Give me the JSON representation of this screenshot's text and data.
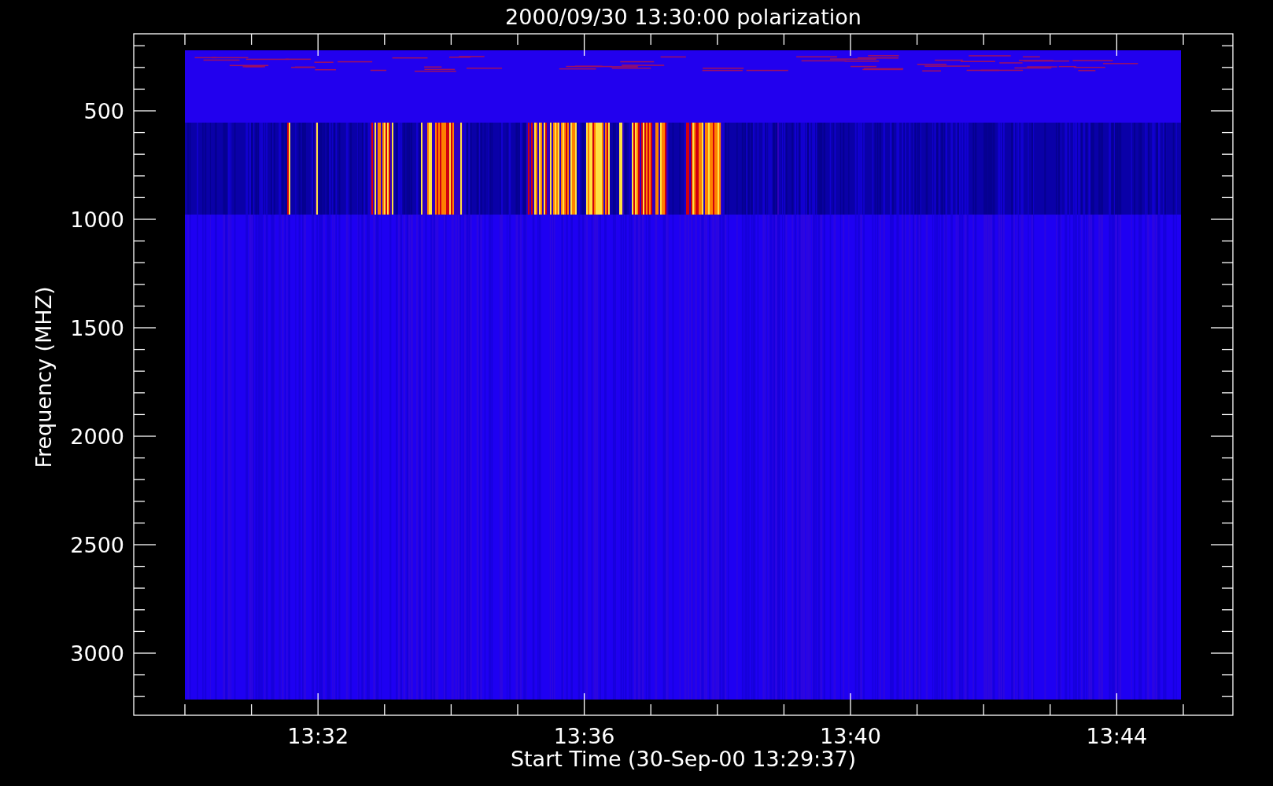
{
  "plot": {
    "title": "2000/09/30 13:30:00 polarization",
    "xlabel": "Start Time (30-Sep-00 13:29:37)",
    "ylabel": "Frequency (MHZ)",
    "yticks": [
      "500",
      "1000",
      "1500",
      "2000",
      "2500",
      "3000"
    ],
    "xticks": [
      "13:32",
      "13:36",
      "13:40",
      "13:44"
    ]
  }
}
